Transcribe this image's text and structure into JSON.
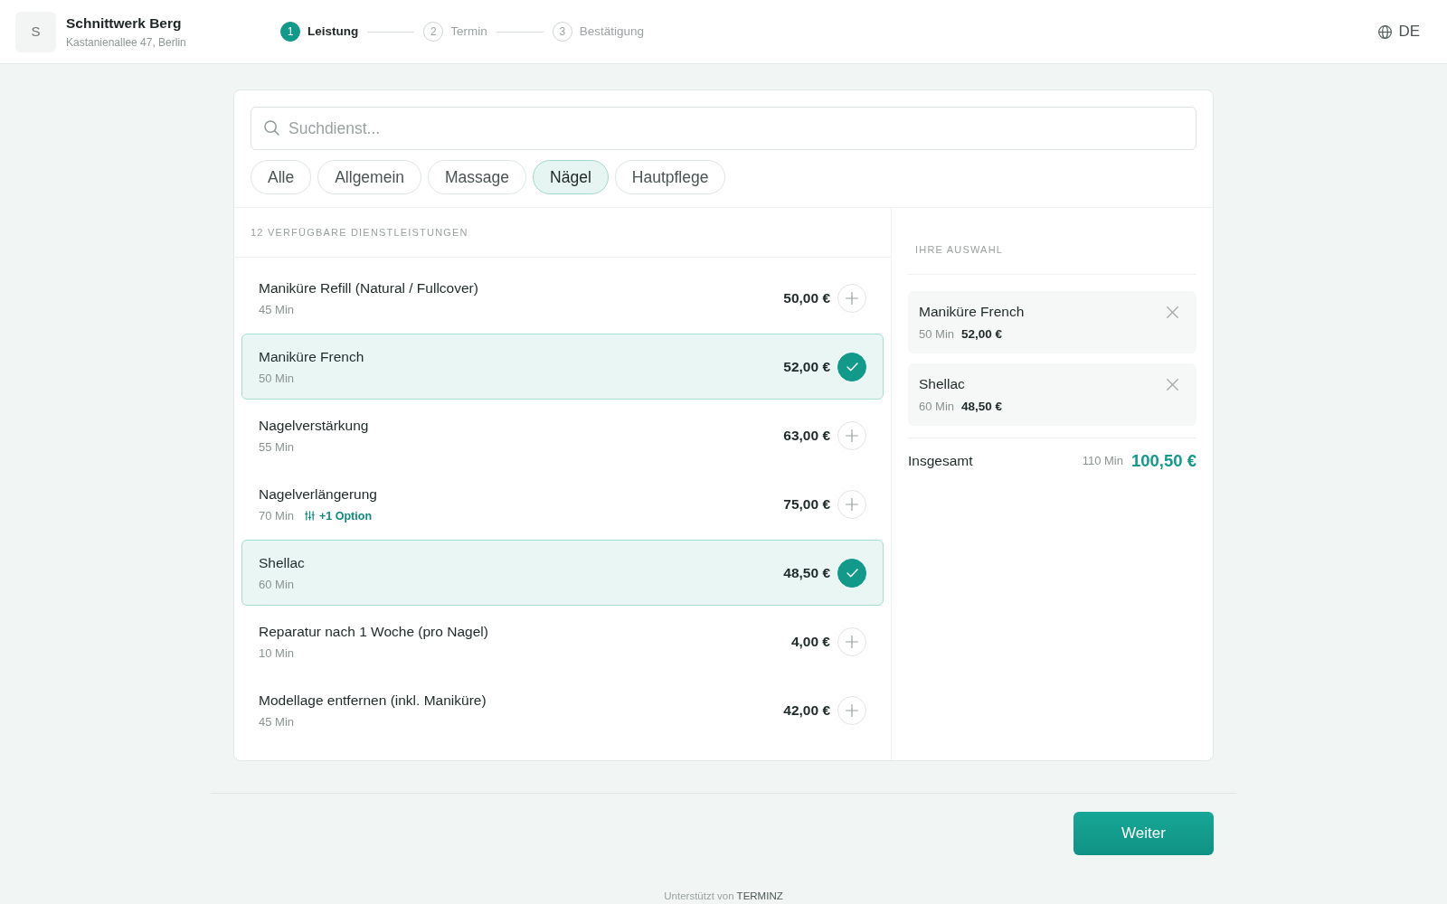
{
  "business": {
    "initial": "S",
    "name": "Schnittwerk Berg",
    "address": "Kastanienallee 47, Berlin"
  },
  "steps": [
    {
      "number": "1",
      "label": "Leistung",
      "selected": true
    },
    {
      "number": "2",
      "label": "Termin",
      "selected": false
    },
    {
      "number": "3",
      "label": "Bestätigung",
      "selected": false
    }
  ],
  "language": "DE",
  "search": {
    "placeholder": "Suchdienst..."
  },
  "categories": [
    {
      "label": "Alle",
      "selected": false
    },
    {
      "label": "Allgemein",
      "selected": false
    },
    {
      "label": "Massage",
      "selected": false
    },
    {
      "label": "Nägel",
      "selected": true
    },
    {
      "label": "Hautpflege",
      "selected": false
    }
  ],
  "services": {
    "heading": "12 VERFÜGBARE DIENSTLEISTUNGEN",
    "items": [
      {
        "name": "Maniküre Refill (Natural / Fullcover)",
        "duration": "45 Min",
        "price": "50,00 €",
        "selected": false
      },
      {
        "name": "Maniküre French",
        "duration": "50 Min",
        "price": "52,00 €",
        "selected": true
      },
      {
        "name": "Nagelverstärkung",
        "duration": "55 Min",
        "price": "63,00 €",
        "selected": false
      },
      {
        "name": "Nagelverlängerung",
        "duration": "70 Min",
        "option": "+1 Option",
        "price": "75,00 €",
        "selected": false
      },
      {
        "name": "Shellac",
        "duration": "60 Min",
        "price": "48,50 €",
        "selected": true
      },
      {
        "name": "Reparatur nach 1 Woche (pro Nagel)",
        "duration": "10 Min",
        "price": "4,00 €",
        "selected": false
      },
      {
        "name": "Modellage entfernen (inkl. Maniküre)",
        "duration": "45 Min",
        "price": "42,00 €",
        "selected": false
      }
    ]
  },
  "selection": {
    "heading": "IHRE AUSWAHL",
    "items": [
      {
        "name": "Maniküre French",
        "duration": "50 Min",
        "price": "52,00 €"
      },
      {
        "name": "Shellac",
        "duration": "60 Min",
        "price": "48,50 €"
      }
    ],
    "total": {
      "label": "Insgesamt",
      "duration": "110 Min",
      "price": "100,50 €"
    }
  },
  "continue_button": "Weiter",
  "footer": {
    "text": "Unterstützt von",
    "link": "TERMINZ"
  }
}
